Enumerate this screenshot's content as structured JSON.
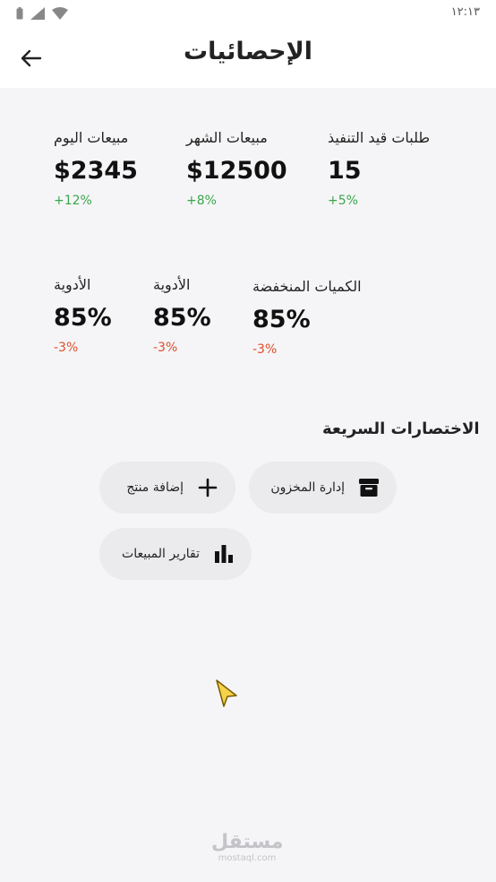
{
  "status_bar": {
    "time": "١٢:١٣",
    "icons": [
      "battery-icon",
      "signal-icon",
      "wifi-icon"
    ]
  },
  "header": {
    "title": "الإحصائيات",
    "back_icon": "arrow-left-icon"
  },
  "stats": [
    {
      "label": "مبيعات اليوم",
      "value": "$2345",
      "change": "+12%",
      "trend": "up"
    },
    {
      "label": "مبيعات الشهر",
      "value": "$12500",
      "change": "+8%",
      "trend": "up"
    },
    {
      "label": "طلبات قيد التنفيذ",
      "value": "15",
      "change": "+5%",
      "trend": "up"
    },
    {
      "label": "الأدوية",
      "value": "85%",
      "change": "-3%",
      "trend": "down"
    },
    {
      "label": "الأدوية",
      "value": "85%",
      "change": "-3%",
      "trend": "down"
    },
    {
      "label": "الكميات المنخفضة",
      "value": "85%",
      "change": "-3%",
      "trend": "down"
    }
  ],
  "shortcuts": {
    "title": "الاختصارات السريعة",
    "items": [
      {
        "label": "إدارة المخزون",
        "icon": "archive-box-icon"
      },
      {
        "label": "إضافة منتج",
        "icon": "plus-icon"
      },
      {
        "label": "تقارير المبيعات",
        "icon": "bar-chart-icon"
      }
    ]
  },
  "watermark": {
    "main": "مستقل",
    "sub": "mostaql.com"
  },
  "colors": {
    "positive": "#3aa64b",
    "negative": "#e04e2b",
    "chip_bg": "#ebebed",
    "page_bg": "#f5f5f7"
  }
}
